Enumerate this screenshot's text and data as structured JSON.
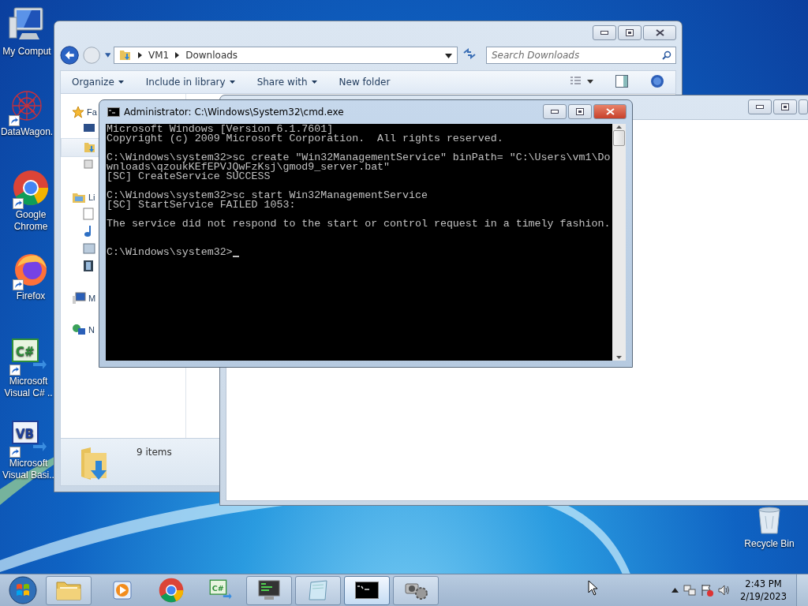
{
  "desktop_icons": [
    {
      "label": "My Comput",
      "kind": "computer",
      "shortcut": false
    },
    {
      "label": "DataWagon.",
      "kind": "web",
      "shortcut": true
    },
    {
      "label": "Google Chrome",
      "kind": "chrome",
      "shortcut": true
    },
    {
      "label": "Firefox",
      "kind": "firefox",
      "shortcut": true
    },
    {
      "label": "Microsoft Visual C# ..",
      "kind": "csharp",
      "badge": "C#",
      "shortcut": true
    },
    {
      "label": "Microsoft Visual Basi..",
      "kind": "vb",
      "badge": "VB",
      "shortcut": true
    },
    {
      "label": "Recycle Bin",
      "kind": "bin",
      "shortcut": false
    }
  ],
  "explorer": {
    "breadcrumb": [
      "VM1",
      "Downloads"
    ],
    "search": {
      "placeholder": "Search Downloads"
    },
    "toolbar": [
      "Organize",
      "Include in library",
      "Share with",
      "New folder"
    ],
    "nav": [
      {
        "label": "Fa",
        "kind": "favorites",
        "children": [
          {
            "selected": false
          },
          {
            "selected": true
          },
          {
            "selected": false
          }
        ]
      },
      {
        "label": "Li",
        "kind": "libraries",
        "children": [
          {
            "selected": false
          },
          {
            "selected": false
          },
          {
            "selected": false
          },
          {
            "selected": false
          }
        ]
      },
      {
        "label": "M",
        "kind": "computer"
      },
      {
        "label": "N",
        "kind": "network"
      }
    ],
    "status": "9 items"
  },
  "cmd": {
    "title": "Administrator: C:\\Windows\\System32\\cmd.exe",
    "lines": [
      {
        "kind": "text",
        "text": "Microsoft Windows [Version 6.1.7601]"
      },
      {
        "kind": "text",
        "text": "Copyright (c) 2009 Microsoft Corporation.  All rights reserved."
      },
      {
        "kind": "blank"
      },
      {
        "kind": "text",
        "text": "C:\\Windows\\system32>sc create \"Win32ManagementService\" binPath= \"C:\\Users\\vm1\\Do"
      },
      {
        "kind": "text",
        "text": "wnloads\\qzoukKEfEPVJQwFzKsj\\gmod9_server.bat\""
      },
      {
        "kind": "text",
        "text": "[SC] CreateService SUCCESS"
      },
      {
        "kind": "blank"
      },
      {
        "kind": "text",
        "text": "C:\\Windows\\system32>sc start Win32ManagementService"
      },
      {
        "kind": "text",
        "text": "[SC] StartService FAILED 1053:"
      },
      {
        "kind": "blank"
      },
      {
        "kind": "text",
        "text": "The service did not respond to the start or control request in a timely fashion."
      },
      {
        "kind": "blank"
      },
      {
        "kind": "blank"
      },
      {
        "kind": "prompt",
        "text": "C:\\Windows\\system32>"
      }
    ]
  },
  "taskbar": {
    "items": [
      {
        "kind": "explorer",
        "open": true,
        "selected": false
      },
      {
        "kind": "media",
        "open": false,
        "selected": false
      },
      {
        "kind": "chrome",
        "open": false,
        "selected": false
      },
      {
        "kind": "csharp",
        "badge": "C#",
        "open": false,
        "selected": false
      },
      {
        "kind": "monitor",
        "open": true,
        "selected": false
      },
      {
        "kind": "notepad",
        "open": true,
        "selected": false
      },
      {
        "kind": "cmd",
        "open": true,
        "selected": true
      },
      {
        "kind": "tool",
        "open": true,
        "selected": false
      }
    ],
    "time": "2:43 PM",
    "date": "2/19/2023"
  }
}
